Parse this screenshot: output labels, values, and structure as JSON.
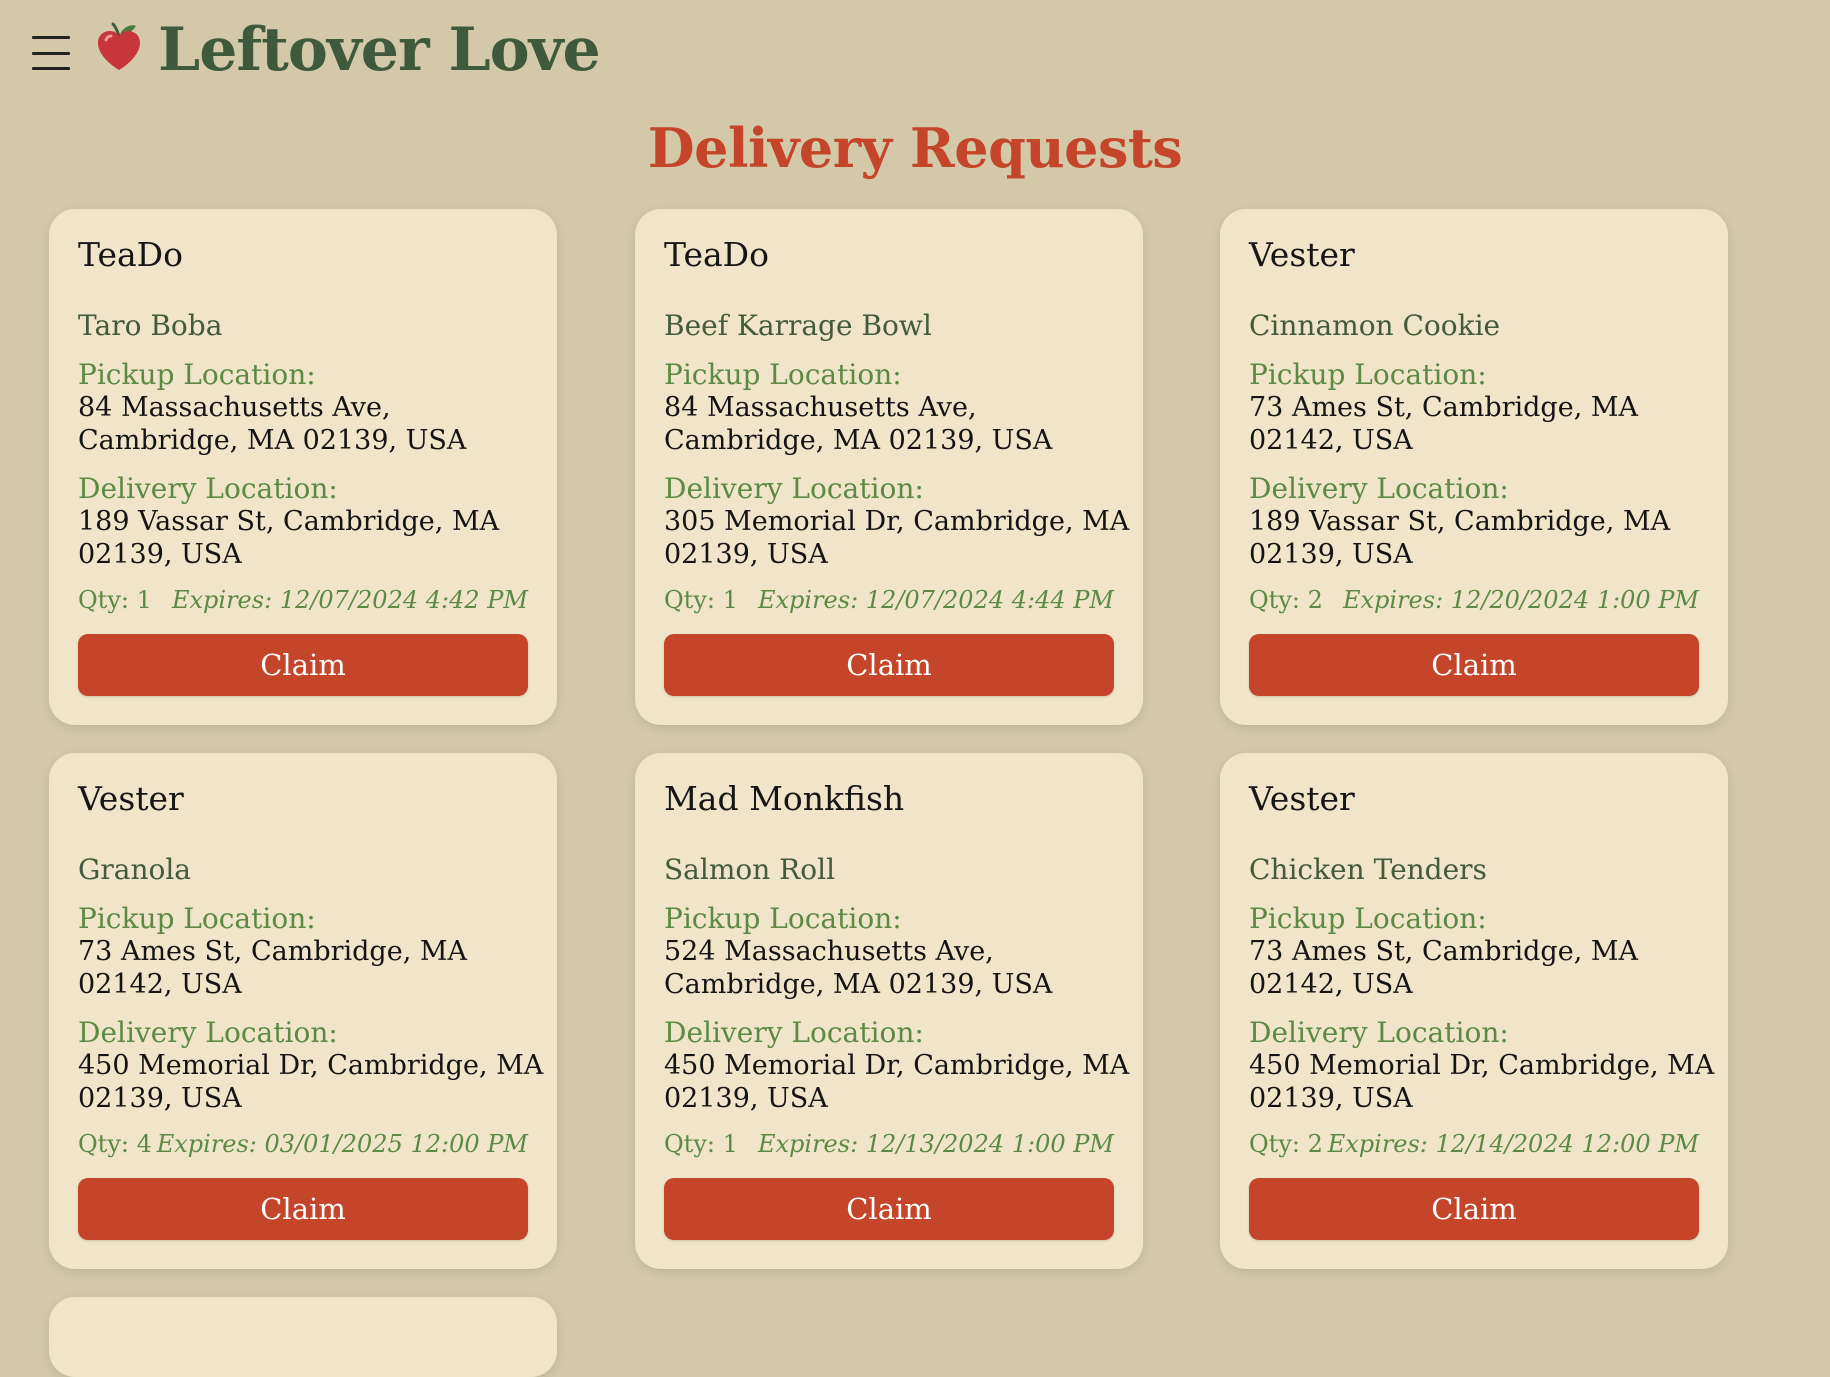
{
  "app": {
    "title": "Leftover Love",
    "menu_icon": "hamburger-menu-icon",
    "logo_icon": "apple-heart-icon",
    "brand_color": "#3f5a3a",
    "accent_color": "#c4452a"
  },
  "page": {
    "title": "Delivery Requests"
  },
  "labels": {
    "pickup": "Pickup Location:",
    "delivery": "Delivery Location:",
    "claim": "Claim"
  },
  "requests": [
    {
      "restaurant": "TeaDo",
      "item": "Taro Boba",
      "pickup": "84 Massachusetts Ave, Cambridge, MA 02139, USA",
      "delivery": "189 Vassar St, Cambridge, MA 02139, USA",
      "qty": "Qty: 1",
      "expires": "Expires: 12/07/2024 4:42 PM"
    },
    {
      "restaurant": "TeaDo",
      "item": "Beef Karrage Bowl",
      "pickup": "84 Massachusetts Ave, Cambridge, MA 02139, USA",
      "delivery": "305 Memorial Dr, Cambridge, MA 02139, USA",
      "qty": "Qty: 1",
      "expires": "Expires: 12/07/2024 4:44 PM"
    },
    {
      "restaurant": "Vester",
      "item": "Cinnamon Cookie",
      "pickup": "73 Ames St, Cambridge, MA 02142, USA",
      "delivery": "189 Vassar St, Cambridge, MA 02139, USA",
      "qty": "Qty: 2",
      "expires": "Expires: 12/20/2024 1:00 PM"
    },
    {
      "restaurant": "Vester",
      "item": "Granola",
      "pickup": "73 Ames St, Cambridge, MA 02142, USA",
      "delivery": "450 Memorial Dr, Cambridge, MA 02139, USA",
      "qty": "Qty: 4",
      "expires": "Expires: 03/01/2025 12:00 PM"
    },
    {
      "restaurant": "Mad Monkfish",
      "item": "Salmon Roll",
      "pickup": "524 Massachusetts Ave, Cambridge, MA 02139, USA",
      "delivery": "450 Memorial Dr, Cambridge, MA 02139, USA",
      "qty": "Qty: 1",
      "expires": "Expires: 12/13/2024 1:00 PM"
    },
    {
      "restaurant": "Vester",
      "item": "Chicken Tenders",
      "pickup": "73 Ames St, Cambridge, MA 02142, USA",
      "delivery": "450 Memorial Dr, Cambridge, MA 02139, USA",
      "qty": "Qty: 2",
      "expires": "Expires: 12/14/2024 12:00 PM"
    }
  ]
}
